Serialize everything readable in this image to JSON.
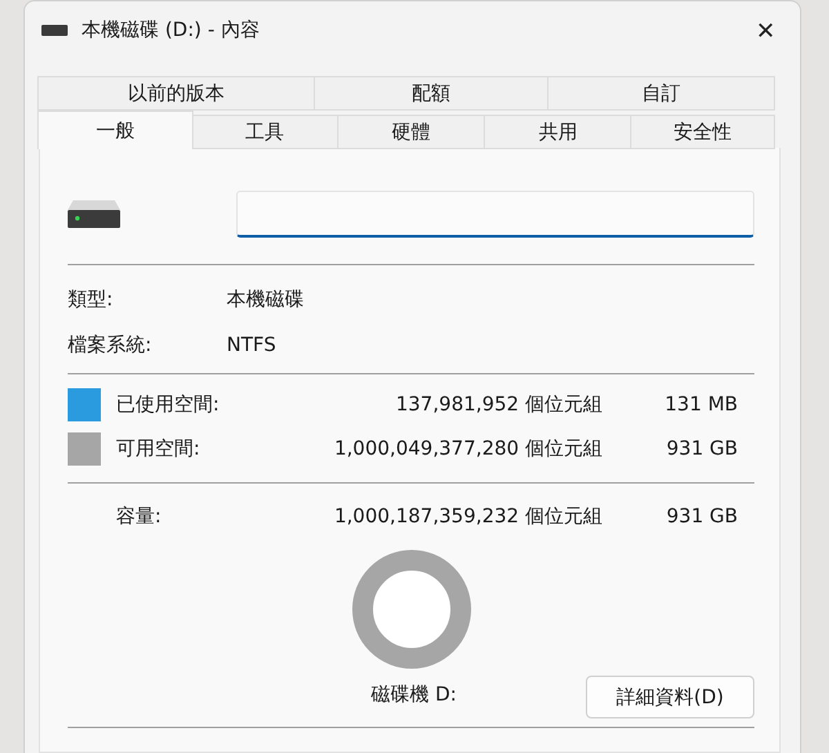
{
  "window": {
    "title": "本機磁碟 (D:) - 內容",
    "close": "✕"
  },
  "tab_rows": [
    [
      {
        "label": "以前的版本",
        "selected": false
      },
      {
        "label": "配額",
        "selected": false
      },
      {
        "label": "自訂",
        "selected": false
      }
    ],
    [
      {
        "label": "一般",
        "selected": true
      },
      {
        "label": "工具",
        "selected": false
      },
      {
        "label": "硬體",
        "selected": false
      },
      {
        "label": "共用",
        "selected": false
      },
      {
        "label": "安全性",
        "selected": false
      }
    ]
  ],
  "info": [
    {
      "label": "類型:",
      "value": "本機磁碟"
    },
    {
      "label": "檔案系統:",
      "value": "NTFS"
    }
  ],
  "space": [
    {
      "label": "已使用空間:",
      "bytes": "137,981,952 個位元組",
      "size": "131 MB",
      "color": "#2b9be0"
    },
    {
      "label": "可用空間:",
      "bytes": "1,000,049,377,280 個位元組",
      "size": "931 GB",
      "color": "#a6a6a6"
    }
  ],
  "capacity": {
    "label": "容量:",
    "bytes": "1,000,187,359,232 個位元組",
    "size": "931 GB"
  },
  "drive_label": "磁碟機 D:",
  "details_button": "詳細資料(D)"
}
